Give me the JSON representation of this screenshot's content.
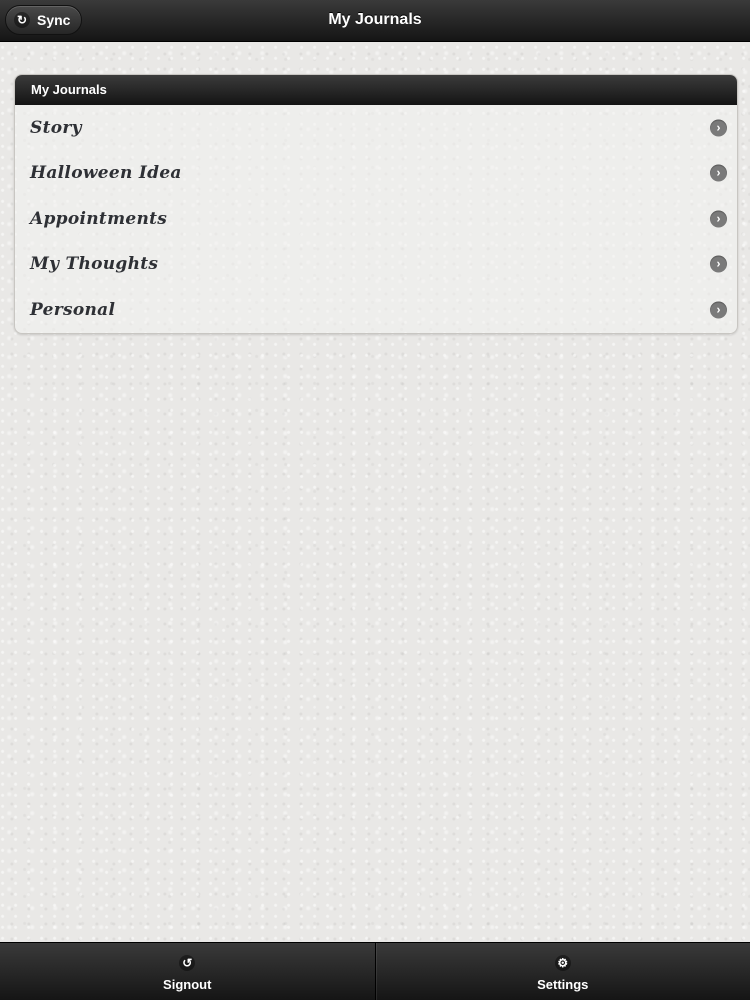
{
  "header": {
    "title": "My Journals",
    "sync_label": "Sync",
    "sync_icon": "refresh-icon"
  },
  "journals": {
    "header": "My Journals",
    "items": [
      {
        "label": "Story"
      },
      {
        "label": "Halloween Idea"
      },
      {
        "label": "Appointments"
      },
      {
        "label": "My Thoughts"
      },
      {
        "label": "Personal"
      }
    ],
    "item_icon": "chevron-right-icon"
  },
  "footer": {
    "signout_label": "Signout",
    "signout_icon": "back-arrow-icon",
    "settings_label": "Settings",
    "settings_icon": "gear-icon"
  },
  "colors": {
    "toolbar": "#1f1f1f",
    "background": "#e9e8e6",
    "item_text": "#2e3035",
    "chevron": "#7a7a7a"
  }
}
